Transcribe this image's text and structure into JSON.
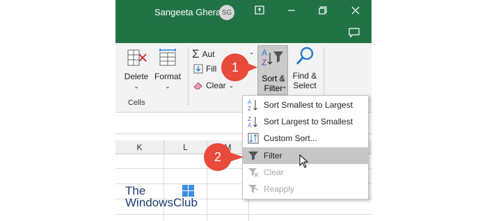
{
  "titlebar": {
    "username": "Sangeeta Ghera",
    "avatar_initials": "SG"
  },
  "ribbon": {
    "delete_label": "Delete",
    "format_label": "Format",
    "cells_group_label": "Cells",
    "autosum_label": "Aut",
    "fill_label": "Fill",
    "clear_label": "Clear",
    "sort_filter_line1": "Sort &",
    "sort_filter_line2": "Filter",
    "find_select_line1": "Find &",
    "find_select_line2": "Select"
  },
  "columns": [
    "K",
    "L",
    "M"
  ],
  "menu": {
    "items": [
      {
        "label": "Sort Smallest to Largest",
        "state": "enabled"
      },
      {
        "label": "Sort Largest to Smallest",
        "state": "enabled"
      },
      {
        "label": "Custom Sort...",
        "state": "enabled"
      },
      {
        "label": "Filter",
        "state": "highlighted"
      },
      {
        "label": "Clear",
        "state": "disabled"
      },
      {
        "label": "Reapply",
        "state": "disabled"
      }
    ]
  },
  "callouts": [
    "1",
    "2"
  ],
  "watermark": {
    "line1": "The",
    "line2": "WindowsClub"
  },
  "colors": {
    "title_bar": "#217346",
    "callout": "#e84a3b",
    "highlight": "#c6c6c6"
  }
}
